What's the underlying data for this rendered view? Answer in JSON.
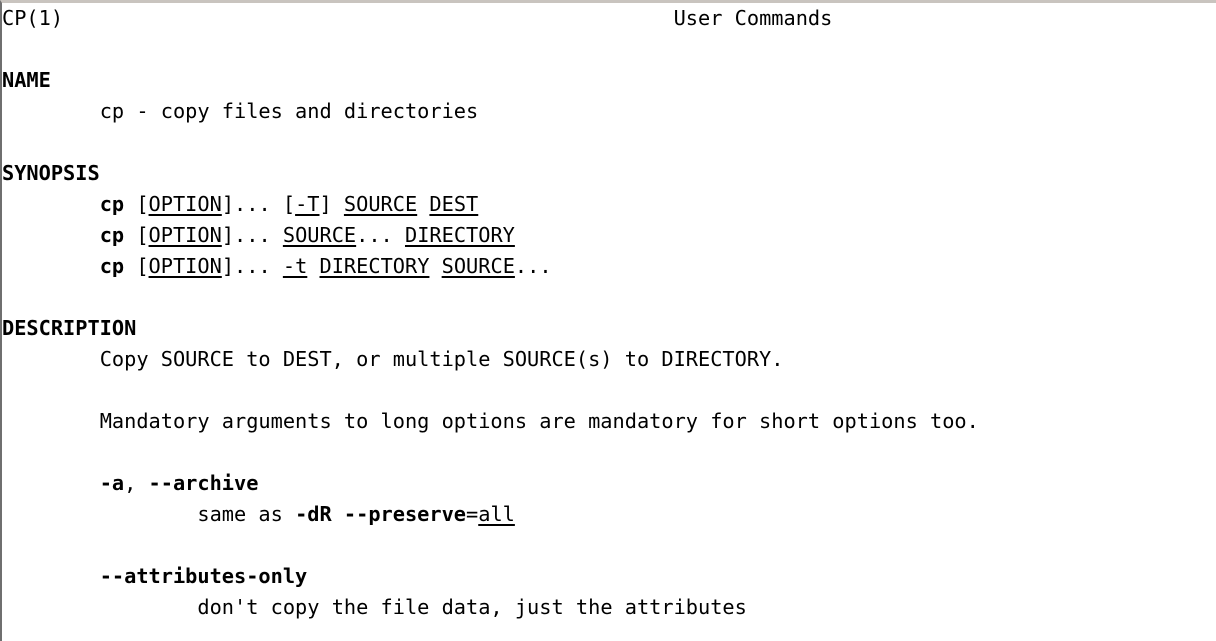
{
  "document": {
    "type": "man-page",
    "page_name": "CP(1)",
    "section_title": "User Commands",
    "background_color": "#ffffff",
    "text_color": "#000000",
    "top_border_color": "#c9c4bf",
    "left_border_color": "#6f6f6f"
  },
  "header": {
    "left": "CP(1)",
    "right": "User Commands"
  },
  "sections": {
    "name": {
      "heading": "NAME",
      "body": "cp - copy files and directories"
    },
    "synopsis": {
      "heading": "SYNOPSIS",
      "lines": [
        {
          "command": "cp",
          "parts": [
            {
              "text": "[",
              "style": "plain"
            },
            {
              "text": "OPTION",
              "style": "underline"
            },
            {
              "text": "]... [",
              "style": "plain"
            },
            {
              "text": "-T",
              "style": "underline"
            },
            {
              "text": "] ",
              "style": "plain"
            },
            {
              "text": "SOURCE",
              "style": "underline"
            },
            {
              "text": " ",
              "style": "plain"
            },
            {
              "text": "DEST",
              "style": "underline"
            }
          ]
        },
        {
          "command": "cp",
          "parts": [
            {
              "text": "[",
              "style": "plain"
            },
            {
              "text": "OPTION",
              "style": "underline"
            },
            {
              "text": "]... ",
              "style": "plain"
            },
            {
              "text": "SOURCE",
              "style": "underline"
            },
            {
              "text": "... ",
              "style": "plain"
            },
            {
              "text": "DIRECTORY",
              "style": "underline"
            }
          ]
        },
        {
          "command": "cp",
          "parts": [
            {
              "text": "[",
              "style": "plain"
            },
            {
              "text": "OPTION",
              "style": "underline"
            },
            {
              "text": "]... ",
              "style": "plain"
            },
            {
              "text": "-t",
              "style": "underline"
            },
            {
              "text": " ",
              "style": "plain"
            },
            {
              "text": "DIRECTORY",
              "style": "underline"
            },
            {
              "text": " ",
              "style": "plain"
            },
            {
              "text": "SOURCE",
              "style": "underline"
            },
            {
              "text": "...",
              "style": "plain"
            }
          ]
        }
      ]
    },
    "description": {
      "heading": "DESCRIPTION",
      "intro": "Copy SOURCE to DEST, or multiple SOURCE(s) to DIRECTORY.",
      "note": "Mandatory arguments to long options are mandatory for short options too.",
      "options": [
        {
          "term_parts": [
            {
              "text": "-a",
              "style": "bold"
            },
            {
              "text": ",",
              "style": "plain"
            },
            {
              "text": " ",
              "style": "plain"
            },
            {
              "text": "--archive",
              "style": "bold"
            }
          ],
          "desc_parts": [
            {
              "text": "same as ",
              "style": "plain"
            },
            {
              "text": "-dR --preserve",
              "style": "bold"
            },
            {
              "text": "=",
              "style": "plain"
            },
            {
              "text": "all",
              "style": "underline"
            }
          ]
        },
        {
          "term_parts": [
            {
              "text": "--attributes-only",
              "style": "bold"
            }
          ],
          "desc_parts": [
            {
              "text": "don't copy the file data, just the attributes",
              "style": "plain"
            }
          ]
        }
      ]
    }
  }
}
